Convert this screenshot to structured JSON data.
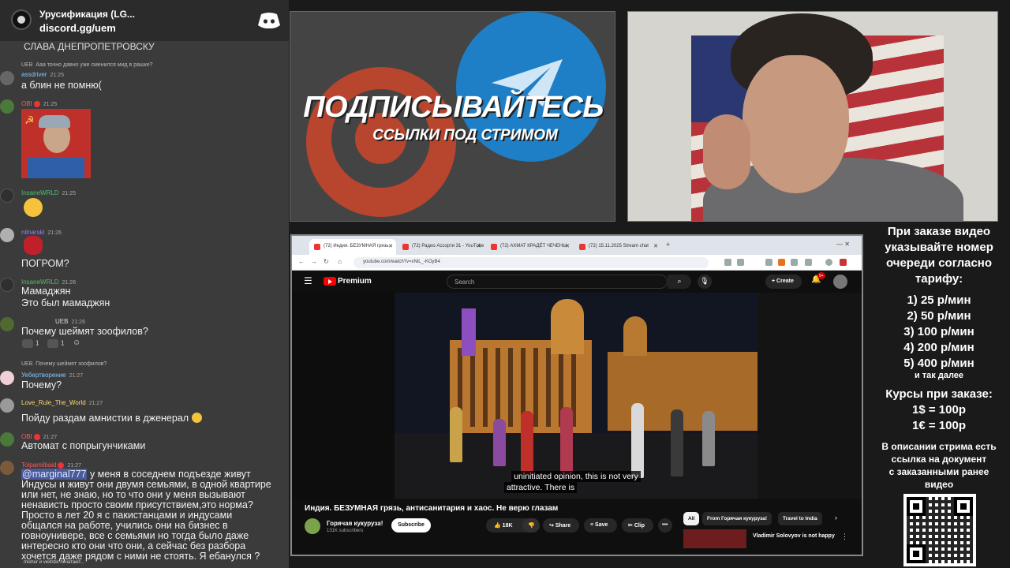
{
  "discord": {
    "server_name": "Урусификация (LG...",
    "invite": "discord.gg/uem"
  },
  "chat": {
    "stub_line": "СЛАВА ДНЕПРОПЕТРОВСКУ",
    "messages": [
      {
        "reply": "Ааа точно давно уже сменился мид в рашке?",
        "badge": "UEB",
        "user": "assdriver",
        "user_color": "#7ec8ff",
        "time": "21:25",
        "body": "а блин не помню("
      },
      {
        "user": "OBI",
        "user_color": "#ff5a5a",
        "time": "21:25",
        "body": ""
      },
      {
        "user": "InsaneWRLD",
        "user_color": "#4fbf6a",
        "time": "21:25",
        "body": ""
      },
      {
        "user": "nilnarski",
        "user_color": "#9a7cff",
        "time": "21:26",
        "body": "ПОГРОМ?"
      },
      {
        "user": "InsaneWRLD",
        "user_color": "#4fbf6a",
        "time": "21:26",
        "body": "Мамаджян",
        "body2": "Это был мамаджян"
      },
      {
        "badge": "UEB",
        "time": "21:26",
        "body": "Почему шеймят зоофилов?",
        "reactions": [
          "1",
          "1"
        ]
      },
      {
        "reply": "Почему шеймят зоофилов?",
        "badge": "UEB",
        "user": "Уебертворение",
        "user_color": "#7ec8ff",
        "time": "21:27",
        "body": "Почему?"
      },
      {
        "user": "Love_Rule_The_World",
        "user_color": "#ffd966",
        "time": "21:27",
        "body": "Пойду раздам амнистии в дженерал"
      },
      {
        "user": "OBI",
        "user_color": "#ff5a5a",
        "time": "21:27",
        "body": "Автомат с попрыгунчиками"
      },
      {
        "user": "Tolpamilbaid",
        "user_color": "#ff5a5a",
        "time": "21:27",
        "mention": "@marginal777",
        "body": " у меня в соседнем подъезде живут",
        "lines": [
          "Индусы и живут они двумя семьями, в одной квартире",
          "или нет, не знаю, но то что они у меня вызывают",
          "ненависть просто своим присутствием,это норма?",
          "Просто в лет 20 я с пакистанцами и индусами",
          "общался на работе, учились они на бизнес в",
          "говноунивере, все с семьями но тогда было даже",
          "интересно кто они что они, а сейчас без разбора",
          "хочется даже рядом с ними не стоять. Я ебанулся ?"
        ]
      }
    ],
    "typing": "mishur и vextstic печатают..."
  },
  "promo": {
    "headline": "ПОДПИСЫВАЙТЕСЬ",
    "subline": "ССЫЛКИ ПОД СТРИМОМ"
  },
  "browser": {
    "tabs": [
      {
        "label": "(72) Индия. БЕЗУМНАЯ грязь"
      },
      {
        "label": "(72) Радио Ассорти 31 - YouTube"
      },
      {
        "label": "(72) АХМАТ КРАДЁТ ЧЕЧЕНЫ"
      },
      {
        "label": "(72) 15.11.2025 Stream chat"
      }
    ],
    "url": "youtube.com/watch?v=xNiL_-KOyB4"
  },
  "youtube": {
    "brand": "Premium",
    "search_placeholder": "Search",
    "create_label": "Create",
    "notifications": "9+",
    "subtitle_line1": "uninitiated opinion, this is not very",
    "subtitle_line2": "attractive.  There is",
    "video_title": "Индия. БЕЗУМНАЯ грязь, антисанитария и хаос. Не верю глазам",
    "channel": "Горячая кукуруза!",
    "subscribers": "131K subscribers",
    "subscribe_label": "Subscribe",
    "likes": "18K",
    "share_label": "Share",
    "save_label": "Save",
    "clip_label": "Clip",
    "chips": [
      "All",
      "From Горячая кукуруза!",
      "Travel to India"
    ],
    "rec_title": "Vladimir Solovyov is not happy"
  },
  "prices": {
    "intro": [
      "При заказе видео",
      "указывайте номер",
      "очереди согласно",
      "тарифу:"
    ],
    "tiers": [
      "1) 25 р/мин",
      "2) 50 р/мин",
      "3) 100 р/мин",
      "4) 200 р/мин",
      "5) 400 р/мин"
    ],
    "etc": "и так далее",
    "rates_title": "Курсы при заказе:",
    "rates": [
      "1$ = 100р",
      "1€ = 100р"
    ],
    "note": [
      "В описании стрима есть",
      "ссылка на документ",
      "с заказанными ранее",
      "видео"
    ]
  },
  "colors": {
    "youtube_red": "#ff0000",
    "chat_bg": "#3b3b3b"
  }
}
